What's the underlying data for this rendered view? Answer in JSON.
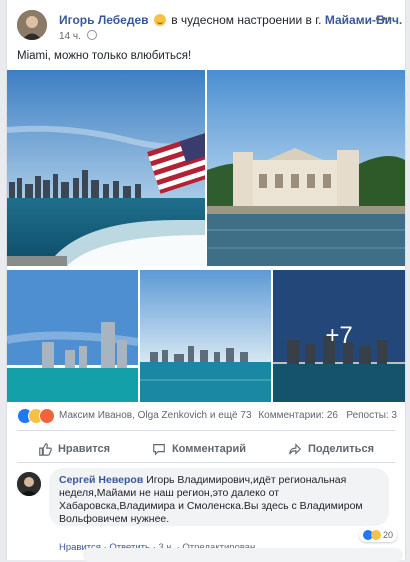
{
  "post": {
    "author": "Игорь Лебедев",
    "activity_prefix": "в чудесном настроении в г.",
    "activity_place": "Майами-Бич.",
    "time": "14 ч.",
    "text": "Miami, можно только влюбиться!",
    "more_photos": "+7"
  },
  "reactions": {
    "names": "Максим Иванов, Olga Zenkovich и ещё 73",
    "comments": "Комментарии: 26",
    "reposts": "Репосты: 3"
  },
  "actions": {
    "like": "Нравится",
    "comment": "Комментарий",
    "share": "Поделиться"
  },
  "comment": {
    "author": "Сергей Неверов",
    "text": "Игорь Владимирович,идёт региональная неделя,Майами не наш регион,это далеко от Хабаровска,Владимира и Смоленска.Вы здесь с Владимиром Вольфовичем нужнее.",
    "reaction_count": "20",
    "like": "Нравится",
    "reply": "Ответить",
    "time": "3 ч.",
    "edited": "Отредактирован"
  }
}
